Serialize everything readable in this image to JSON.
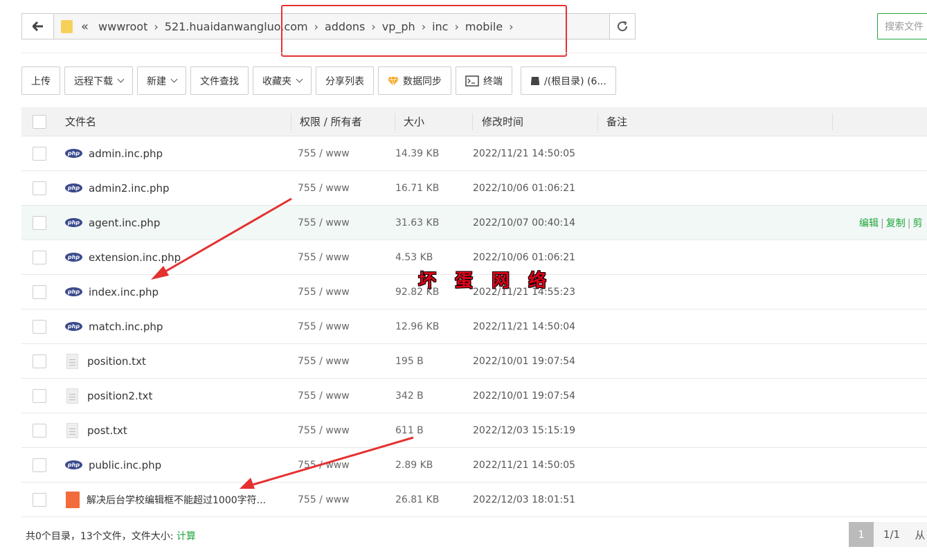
{
  "pathbar": {
    "crumbs": [
      "wwwroot",
      "521.huaidanwangluo.com",
      "addons",
      "vp_ph",
      "inc",
      "mobile"
    ]
  },
  "search": {
    "placeholder": "搜索文件"
  },
  "toolbar": {
    "upload": "上传",
    "remote_download": "远程下载",
    "new": "新建",
    "file_search": "文件查找",
    "favorites": "收藏夹",
    "share_list": "分享列表",
    "data_sync": "数据同步",
    "terminal": "终端",
    "root_dir": "/(根目录) (6..."
  },
  "table": {
    "headers": {
      "name": "文件名",
      "perm": "权限 / 所有者",
      "size": "大小",
      "mtime": "修改时间",
      "remark": "备注"
    },
    "rows": [
      {
        "type": "php",
        "name": "admin.inc.php",
        "perm": "755 / www",
        "size": "14.39 KB",
        "mtime": "2022/11/21 14:50:05"
      },
      {
        "type": "php",
        "name": "admin2.inc.php",
        "perm": "755 / www",
        "size": "16.71 KB",
        "mtime": "2022/10/06 01:06:21"
      },
      {
        "type": "php",
        "name": "agent.inc.php",
        "perm": "755 / www",
        "size": "31.63 KB",
        "mtime": "2022/10/07 00:40:14"
      },
      {
        "type": "php",
        "name": "extension.inc.php",
        "perm": "755 / www",
        "size": "4.53 KB",
        "mtime": "2022/10/06 01:06:21"
      },
      {
        "type": "php",
        "name": "index.inc.php",
        "perm": "755 / www",
        "size": "92.82 KB",
        "mtime": "2022/11/21 14:55:23"
      },
      {
        "type": "php",
        "name": "match.inc.php",
        "perm": "755 / www",
        "size": "12.96 KB",
        "mtime": "2022/11/21 14:50:04"
      },
      {
        "type": "txt",
        "name": "position.txt",
        "perm": "755 / www",
        "size": "195 B",
        "mtime": "2022/10/01 19:07:54"
      },
      {
        "type": "txt",
        "name": "position2.txt",
        "perm": "755 / www",
        "size": "342 B",
        "mtime": "2022/10/01 19:07:54"
      },
      {
        "type": "txt",
        "name": "post.txt",
        "perm": "755 / www",
        "size": "611 B",
        "mtime": "2022/12/03 15:15:19"
      },
      {
        "type": "php",
        "name": "public.inc.php",
        "perm": "755 / www",
        "size": "2.89 KB",
        "mtime": "2022/11/21 14:50:05"
      },
      {
        "type": "zip",
        "name": "解决后台学校编辑框不能超过1000字符...",
        "perm": "755 / www",
        "size": "26.81 KB",
        "mtime": "2022/12/03 18:01:51"
      }
    ],
    "hover_actions": {
      "edit": "编辑",
      "copy": "复制",
      "cut": "剪"
    }
  },
  "footer": {
    "summary": "共0个目录，13个文件，文件大小: ",
    "calc": "计算"
  },
  "pager": {
    "current": "1",
    "total": "1/1",
    "from": "从"
  },
  "watermark": "坏 蛋 网 络",
  "colors": {
    "accent": "#20a53a",
    "annotation": "#e53030"
  }
}
